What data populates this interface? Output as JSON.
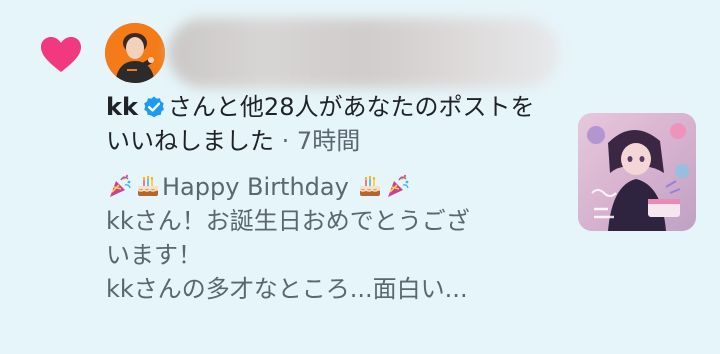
{
  "notification": {
    "type_icon": "heart-icon",
    "user_name": "kk",
    "verified_icon": "verified-badge-icon",
    "action_text": "さんと他28人があなたのポストをいいねしました",
    "separator": "·",
    "time_ago": "7時間",
    "preview": {
      "line1_emojis_left": [
        "party-popper-icon",
        "birthday-cake-icon"
      ],
      "line1_text": "Happy Birthday",
      "line1_emojis_right": [
        "birthday-cake-icon",
        "party-popper-icon"
      ],
      "line2": "kkさん！お誕生日おめでとうござ",
      "line3": "います！",
      "line4": "kkさんの多才なところ...面白い..."
    },
    "thumbnail_icon": "post-image-thumbnail"
  },
  "colors": {
    "background": "#e6f5fa",
    "heart": "#f2387f",
    "verified": "#1d9bf0",
    "avatar_bg": "#f47b18",
    "text_primary": "#1f2328",
    "text_secondary": "#5b6670"
  }
}
